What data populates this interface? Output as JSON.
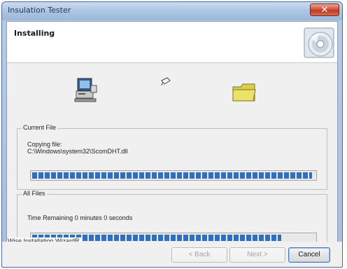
{
  "window": {
    "title": "Insulation Tester",
    "close_label": "✕"
  },
  "header": {
    "title": "Installing"
  },
  "current_file": {
    "legend": "Current File",
    "status_line": "Copying file:",
    "file_path": "C:\\Windows\\system32\\ScomDHT.dll",
    "progress": 0.99
  },
  "all_files": {
    "legend": "All Files",
    "time_remaining": "Time Remaining 0 minutes 0 seconds",
    "progress": 0.88
  },
  "footer": {
    "brand": "Wise Installation WizardR"
  },
  "buttons": {
    "back": "< Back",
    "next": "Next >",
    "cancel": "Cancel"
  },
  "colors": {
    "progress": "#2e6fc0",
    "title_bar": "#aac3e2",
    "close_button": "#c13b22"
  },
  "icons": {
    "cd": "cd-disc-icon",
    "computer": "computer-icon",
    "flying_file": "flying-file-icon",
    "folder": "folder-icon"
  }
}
